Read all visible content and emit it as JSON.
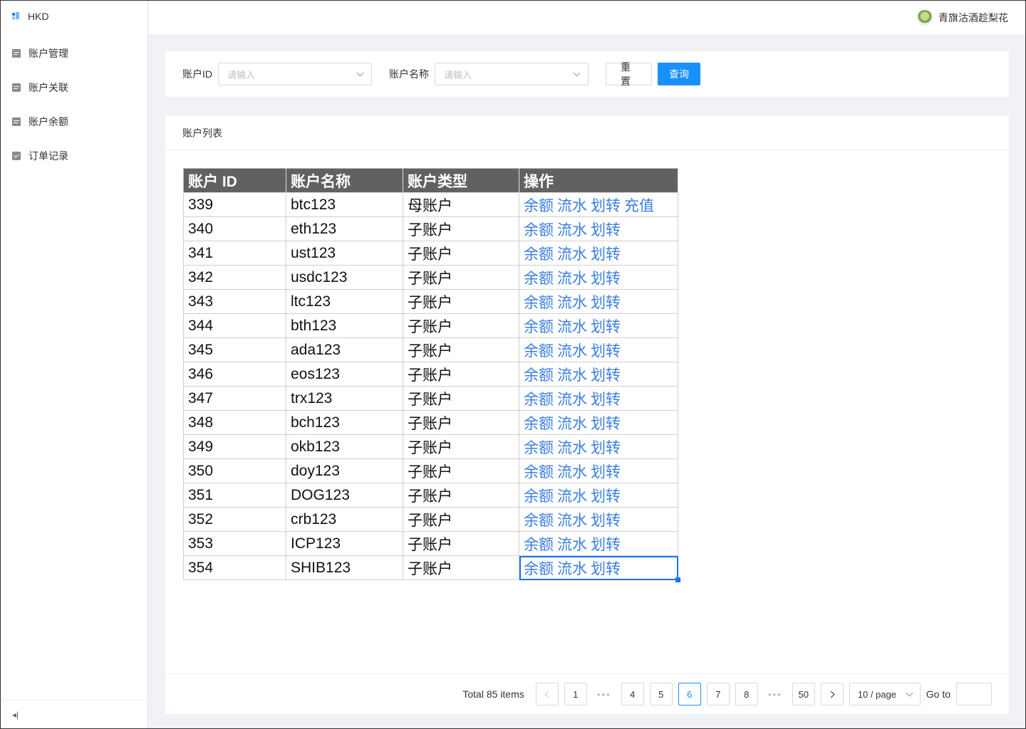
{
  "app": {
    "name": "HKD"
  },
  "sidebar": {
    "items": [
      {
        "label": "账户管理",
        "icon": "list-icon"
      },
      {
        "label": "账户关联",
        "icon": "list-icon"
      },
      {
        "label": "账户余额",
        "icon": "list-icon"
      },
      {
        "label": "订单记录",
        "icon": "checkbox-icon"
      }
    ],
    "collapse_icon": "collapse-left-icon"
  },
  "header": {
    "user_name": "青旗沽酒趁梨花"
  },
  "filters": {
    "account_id_label": "账户ID",
    "account_id_placeholder": "请输入",
    "account_name_label": "账户名称",
    "account_name_placeholder": "请输入",
    "reset_label": "重置",
    "query_label": "查询"
  },
  "list": {
    "title": "账户列表",
    "columns": [
      "账户 ID",
      "账户名称",
      "账户类型",
      "操作"
    ],
    "rows": [
      {
        "id": "339",
        "name": "btc123",
        "type": "母账户",
        "actions": [
          "余额",
          "流水",
          "划转",
          "充值"
        ]
      },
      {
        "id": "340",
        "name": "eth123",
        "type": "子账户",
        "actions": [
          "余额",
          "流水",
          "划转"
        ]
      },
      {
        "id": "341",
        "name": "ust123",
        "type": "子账户",
        "actions": [
          "余额",
          "流水",
          "划转"
        ]
      },
      {
        "id": "342",
        "name": "usdc123",
        "type": "子账户",
        "actions": [
          "余额",
          "流水",
          "划转"
        ]
      },
      {
        "id": "343",
        "name": "ltc123",
        "type": "子账户",
        "actions": [
          "余额",
          "流水",
          "划转"
        ]
      },
      {
        "id": "344",
        "name": "bth123",
        "type": "子账户",
        "actions": [
          "余额",
          "流水",
          "划转"
        ]
      },
      {
        "id": "345",
        "name": "ada123",
        "type": "子账户",
        "actions": [
          "余额",
          "流水",
          "划转"
        ]
      },
      {
        "id": "346",
        "name": "eos123",
        "type": "子账户",
        "actions": [
          "余额",
          "流水",
          "划转"
        ]
      },
      {
        "id": "347",
        "name": "trx123",
        "type": "子账户",
        "actions": [
          "余额",
          "流水",
          "划转"
        ]
      },
      {
        "id": "348",
        "name": "bch123",
        "type": "子账户",
        "actions": [
          "余额",
          "流水",
          "划转"
        ]
      },
      {
        "id": "349",
        "name": "okb123",
        "type": "子账户",
        "actions": [
          "余额",
          "流水",
          "划转"
        ]
      },
      {
        "id": "350",
        "name": "doy123",
        "type": "子账户",
        "actions": [
          "余额",
          "流水",
          "划转"
        ]
      },
      {
        "id": "351",
        "name": "DOG123",
        "type": "子账户",
        "actions": [
          "余额",
          "流水",
          "划转"
        ]
      },
      {
        "id": "352",
        "name": "crb123",
        "type": "子账户",
        "actions": [
          "余额",
          "流水",
          "划转"
        ]
      },
      {
        "id": "353",
        "name": "ICP123",
        "type": "子账户",
        "actions": [
          "余额",
          "流水",
          "划转"
        ]
      },
      {
        "id": "354",
        "name": "SHIB123",
        "type": "子账户",
        "actions": [
          "余额",
          "流水",
          "划转"
        ]
      }
    ]
  },
  "pagination": {
    "total_text": "Total 85 items",
    "pages": [
      "1",
      "...",
      "4",
      "5",
      "6",
      "7",
      "8",
      "...",
      "50"
    ],
    "current": "6",
    "page_size_label": "10 / page",
    "goto_label": "Go to"
  },
  "colors": {
    "primary": "#1890ff",
    "link": "#3a7fe0",
    "table_header": "#616161"
  }
}
